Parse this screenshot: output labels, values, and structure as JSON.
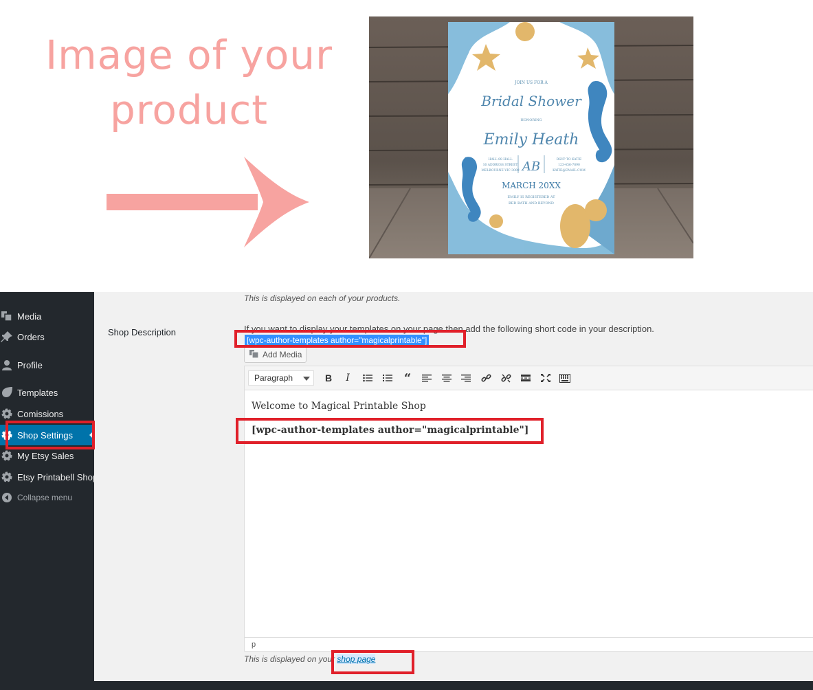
{
  "hero": {
    "line1": "Image of your",
    "line2": "product",
    "arrow_color": "#f7a3a0"
  },
  "product_image": {
    "invitation": {
      "join": "JOIN US FOR A",
      "event": "Bridal Shower",
      "honoring": "HONORING",
      "name": "Emily Heath",
      "venue_lines": [
        "HALL 88 HALL",
        "16 ADDRESS STREET",
        "MELBOURNE VIC 3000"
      ],
      "monogram": "AB",
      "rsvp_lines": [
        "RSVP TO KATIE",
        "123-456-7890",
        "KATIE@EMAIL.COM"
      ],
      "date": "MARCH 20XX",
      "registry_line1": "EMILY IS REGISTERED AT",
      "registry_line2": "BED BATH AND BEYOND"
    }
  },
  "sidebar": {
    "items": [
      {
        "label": "Media",
        "icon": "media-icon"
      },
      {
        "label": "Orders",
        "icon": "pin-icon"
      },
      {
        "label": "Profile",
        "icon": "user-icon"
      },
      {
        "label": "Templates",
        "icon": "templates-icon"
      },
      {
        "label": "Comissions",
        "icon": "gear-icon"
      },
      {
        "label": "Shop Settings",
        "icon": "gear-icon"
      },
      {
        "label": "My Etsy Sales",
        "icon": "gear-icon"
      },
      {
        "label": "Etsy Printabell Shop",
        "icon": "gear-icon"
      },
      {
        "label": "Collapse menu",
        "icon": "collapse-icon"
      }
    ],
    "active": "Shop Settings"
  },
  "settings": {
    "clipped_note": "This is displayed on each of your products.",
    "field_label": "Shop Description",
    "help_text": "If you want to display your templates on your page then add the following short code in your description.",
    "shortcode": "[wpc-author-templates author=\"magicalprintable\"]",
    "add_media": "Add Media"
  },
  "editor": {
    "format": "Paragraph",
    "toolbar": [
      "bold-icon",
      "italic-icon",
      "bullet-list-icon",
      "numbered-list-icon",
      "blockquote-icon",
      "align-left-icon",
      "align-center-icon",
      "align-right-icon",
      "link-icon",
      "unlink-icon",
      "read-more-icon",
      "fullscreen-icon",
      "toolbar-toggle-icon"
    ],
    "paragraph1": "Welcome to Magical Printable Shop",
    "paragraph2": "[wpc-author-templates author=\"magicalprintable\"]",
    "status_path": "p"
  },
  "footer_note": {
    "prefix": "This is displayed on your",
    "link": "shop page"
  },
  "colors": {
    "annotation_red": "#e0202a",
    "admin_dark": "#23282d",
    "wp_blue": "#0073aa",
    "selection_blue": "#3390ff"
  }
}
